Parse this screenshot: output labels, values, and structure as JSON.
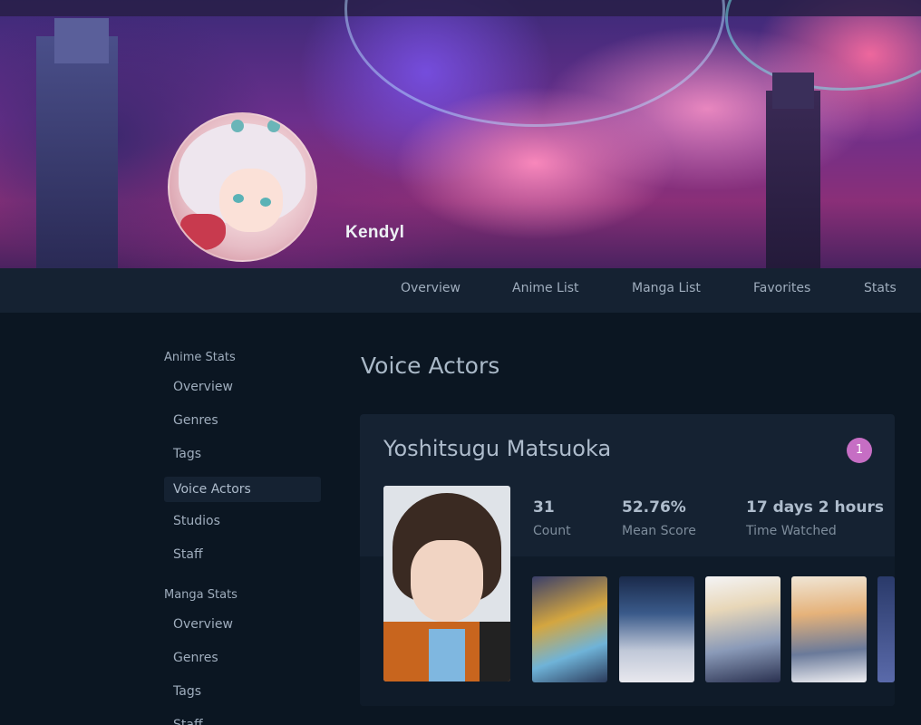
{
  "profile": {
    "username": "Kendyl"
  },
  "nav": {
    "items": [
      "Overview",
      "Anime List",
      "Manga List",
      "Favorites",
      "Stats"
    ]
  },
  "sidebar": {
    "anime_heading": "Anime Stats",
    "anime_items": [
      "Overview",
      "Genres",
      "Tags",
      "Voice Actors",
      "Studios",
      "Staff"
    ],
    "manga_heading": "Manga Stats",
    "manga_items": [
      "Overview",
      "Genres",
      "Tags",
      "Staff"
    ],
    "active": "Voice Actors"
  },
  "main": {
    "title": "Voice Actors",
    "card": {
      "name": "Yoshitsugu Matsuoka",
      "rank": "1",
      "stats": [
        {
          "value": "31",
          "label": "Count"
        },
        {
          "value": "52.76%",
          "label": "Mean Score"
        },
        {
          "value": "17 days 2 hours",
          "label": "Time Watched"
        }
      ]
    }
  },
  "colors": {
    "page_bg": "#0b1622",
    "nav_bg": "#152232",
    "card_bg": "#152232",
    "text": "#9fadbd",
    "rank_badge": "#c66ec4"
  }
}
